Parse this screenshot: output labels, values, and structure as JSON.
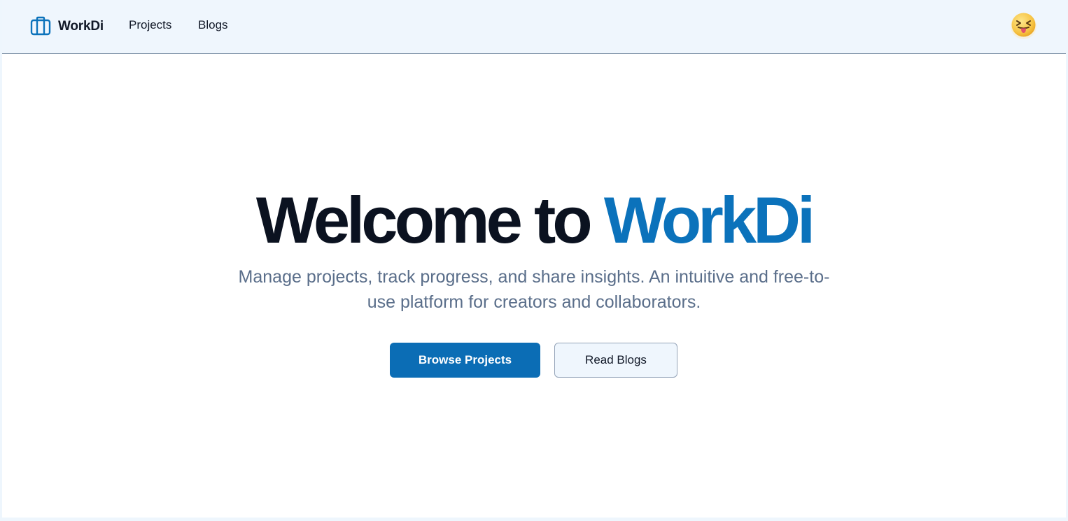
{
  "nav": {
    "brand_name": "WorkDi",
    "links": [
      {
        "label": "Projects"
      },
      {
        "label": "Blogs"
      }
    ],
    "brand_icon": "briefcase-icon",
    "avatar_icon": "squinting-tongue-emoji"
  },
  "hero": {
    "headline_prefix": "Welcome to ",
    "headline_accent": "WorkDi",
    "subtitle": "Manage projects, track progress, and share insights. An intuitive and free-to-use platform for creators and collaborators.",
    "primary_button": "Browse Projects",
    "secondary_button": "Read Blogs"
  },
  "colors": {
    "accent": "#0b72bb",
    "primary_button": "#0b6db5",
    "nav_background": "#eff6fd",
    "headline": "#0b1220",
    "subtitle": "#5a6e8a"
  }
}
